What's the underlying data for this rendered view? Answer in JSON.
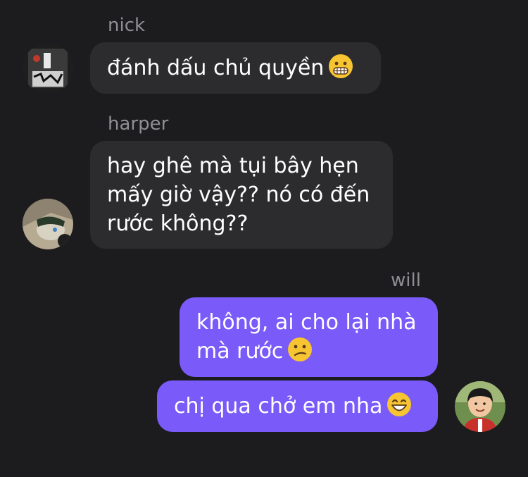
{
  "messages": [
    {
      "sender": "nick",
      "text": "đánh dấu chủ quyền",
      "emoji": "grimacing-face"
    },
    {
      "sender": "harper",
      "lines": [
        "hay ghê mà tụi bây hẹn",
        "mấy giờ vậy?? nó có đến",
        "rước không??"
      ]
    },
    {
      "sender": "will",
      "lines": [
        "không, ai cho lại nhà",
        "mà rước"
      ],
      "emoji": "confused-face"
    },
    {
      "sender": "",
      "text": "chị qua chở em nha",
      "emoji": "grinning-smiling-eyes-face"
    }
  ],
  "colors": {
    "background": "#1c1c1e",
    "incoming_bubble": "#2c2c2e",
    "outgoing_bubble": "#7a5af8",
    "sender_name": "#8e8e93",
    "text": "#ffffff",
    "emoji_yellow": "#f7c531"
  }
}
